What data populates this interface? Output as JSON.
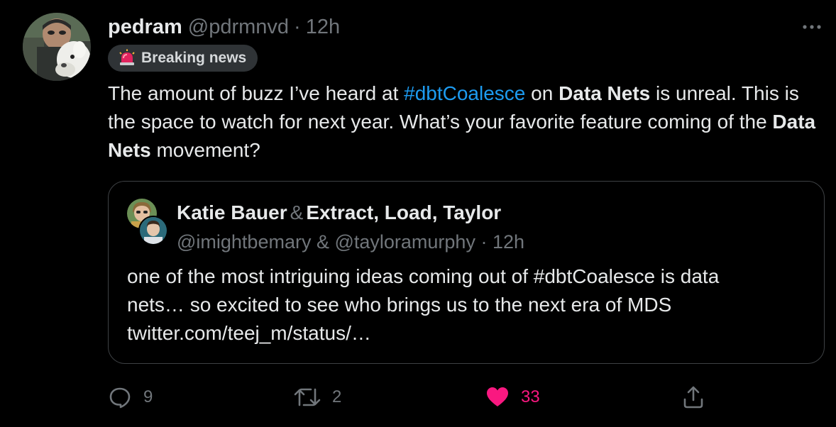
{
  "tweet": {
    "author": {
      "display_name": "pedram",
      "handle": "@pdrmnvd",
      "separator": "·",
      "time": "12h"
    },
    "badge": {
      "icon": "siren-icon",
      "label": "Breaking news"
    },
    "text": {
      "part1": "The amount of buzz I’ve heard at ",
      "hashtag": "#dbtCoalesce",
      "part2": " on ",
      "bold1": "Data Nets",
      "part3": " is unreal. This is the space to watch for next year. What’s your favorite feature coming of the ",
      "bold2": "Data Nets",
      "part4": " movement?"
    },
    "quote": {
      "name1": "Katie Bauer",
      "amp": "&",
      "name2": "Extract, Load, Taylor",
      "handles": "@imightbemary & @tayloramurphy",
      "separator": "·",
      "time": "12h",
      "text_line1": "one of the most intriguing ideas coming out of #dbtCoalesce is data",
      "text_line2": "nets… so excited to see who brings us to the next era of MDS",
      "text_line3": "twitter.com/teej_m/status/…"
    },
    "actions": {
      "reply_count": "9",
      "retweet_count": "2",
      "like_count": "33"
    },
    "colors": {
      "background": "#000000",
      "text": "#e7e9ea",
      "muted": "#71767b",
      "link": "#1d9bf0",
      "like": "#f91880",
      "border": "#3e4144"
    }
  }
}
